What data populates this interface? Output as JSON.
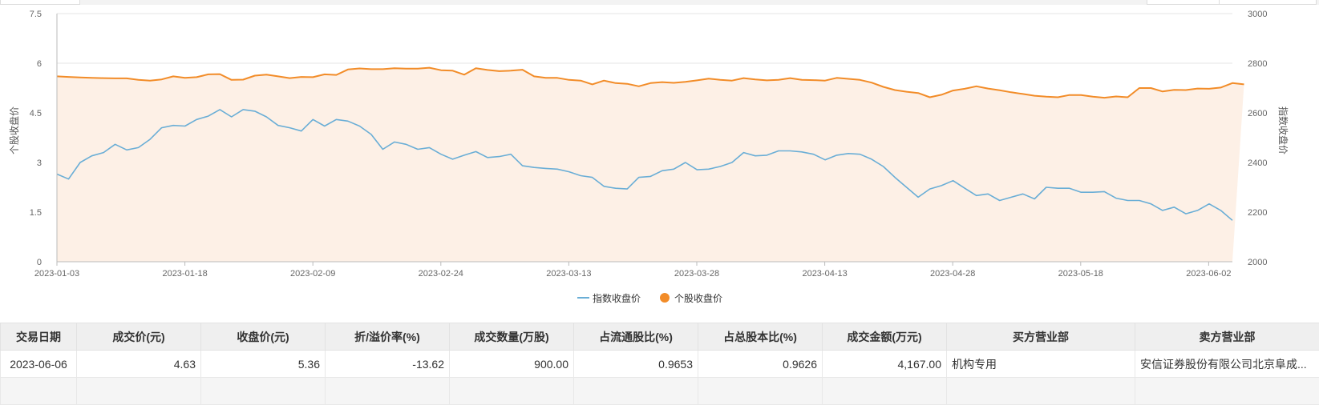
{
  "colors": {
    "index_line": "#6aaed6",
    "stock_line": "#f28c28",
    "stock_area": "#fdf0e6",
    "grid": "#e6e6e6",
    "axis": "#bbbbbb"
  },
  "chart_data": {
    "type": "line",
    "x_ticks": [
      "2023-01-03",
      "2023-01-18",
      "2023-02-09",
      "2023-02-24",
      "2023-03-13",
      "2023-03-28",
      "2023-04-13",
      "2023-04-28",
      "2023-05-18",
      "2023-06-02"
    ],
    "y_left": {
      "label": "个股收盘价",
      "ticks": [
        "0",
        "1.5",
        "3",
        "4.5",
        "6",
        "7.5"
      ],
      "range": [
        0,
        7.5
      ]
    },
    "y_right": {
      "label": "指数收盘价",
      "ticks": [
        "2000",
        "2200",
        "2400",
        "2600",
        "2800",
        "3000"
      ],
      "range": [
        2000,
        3000
      ]
    },
    "legend": {
      "position": "bottom-center"
    },
    "series": [
      {
        "name": "指数收盘价",
        "axis": "left",
        "style": "line",
        "values": [
          2.65,
          2.5,
          3.0,
          3.2,
          3.3,
          3.55,
          3.38,
          3.45,
          3.7,
          4.05,
          4.12,
          4.1,
          4.3,
          4.4,
          4.6,
          4.38,
          4.6,
          4.55,
          4.38,
          4.12,
          4.05,
          3.95,
          4.3,
          4.1,
          4.3,
          4.25,
          4.1,
          3.85,
          3.4,
          3.62,
          3.55,
          3.4,
          3.45,
          3.25,
          3.1,
          3.22,
          3.33,
          3.15,
          3.18,
          3.25,
          2.9,
          2.85,
          2.82,
          2.8,
          2.72,
          2.6,
          2.55,
          2.28,
          2.22,
          2.2,
          2.55,
          2.58,
          2.75,
          2.8,
          3.0,
          2.78,
          2.8,
          2.88,
          3.0,
          3.3,
          3.2,
          3.22,
          3.35,
          3.35,
          3.32,
          3.25,
          3.08,
          3.22,
          3.27,
          3.25,
          3.1,
          2.88,
          2.55,
          2.25,
          1.95,
          2.2,
          2.3,
          2.45,
          2.22,
          2.0,
          2.05,
          1.85,
          1.95,
          2.05,
          1.9,
          2.25,
          2.22,
          2.22,
          2.1,
          2.1,
          2.12,
          1.92,
          1.85,
          1.85,
          1.75,
          1.55,
          1.65,
          1.45,
          1.55,
          1.75,
          1.55,
          1.25
        ]
      },
      {
        "name": "个股收盘价",
        "axis": "right",
        "style": "area",
        "values": [
          2747,
          2745,
          2743,
          2741,
          2740,
          2739,
          2739,
          2733,
          2730,
          2735,
          2747,
          2741,
          2744,
          2755,
          2756,
          2733,
          2734,
          2750,
          2754,
          2747,
          2740,
          2745,
          2744,
          2755,
          2753,
          2775,
          2779,
          2776,
          2776,
          2780,
          2778,
          2778,
          2782,
          2772,
          2770,
          2754,
          2780,
          2773,
          2768,
          2770,
          2774,
          2747,
          2741,
          2741,
          2733,
          2730,
          2715,
          2730,
          2720,
          2717,
          2707,
          2720,
          2724,
          2721,
          2725,
          2731,
          2738,
          2733,
          2730,
          2740,
          2735,
          2731,
          2733,
          2740,
          2733,
          2732,
          2730,
          2741,
          2737,
          2733,
          2722,
          2705,
          2692,
          2685,
          2680,
          2663,
          2673,
          2690,
          2697,
          2707,
          2698,
          2691,
          2683,
          2676,
          2669,
          2665,
          2663,
          2672,
          2672,
          2665,
          2661,
          2666,
          2663,
          2700,
          2700,
          2686,
          2693,
          2692,
          2698,
          2697,
          2702,
          2720,
          2715
        ]
      }
    ]
  },
  "table": {
    "headers": [
      "交易日期",
      "成交价(元)",
      "收盘价(元)",
      "折/溢价率(%)",
      "成交数量(万股)",
      "占流通股比(%)",
      "占总股本比(%)",
      "成交金额(万元)",
      "买方营业部",
      "卖方营业部"
    ],
    "rows": [
      [
        "2023-06-06",
        "4.63",
        "5.36",
        "-13.62",
        "900.00",
        "0.9653",
        "0.9626",
        "4,167.00",
        "机构专用",
        "安信证券股份有限公司北京阜成..."
      ]
    ]
  }
}
